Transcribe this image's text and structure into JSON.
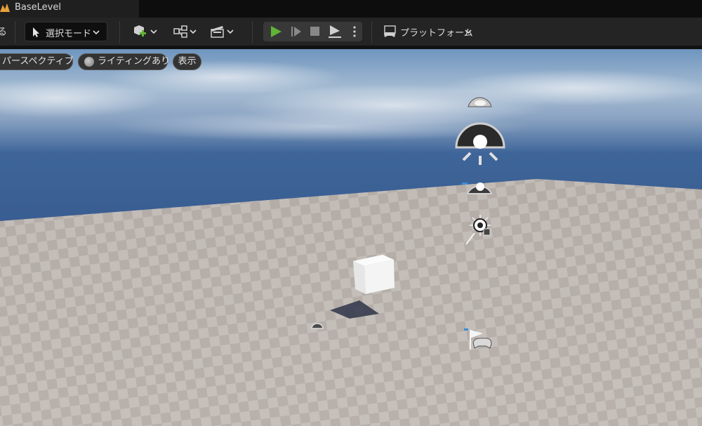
{
  "tab": {
    "title": "BaseLevel",
    "icon": "unreal-level-icon"
  },
  "toolbar": {
    "cut_text": "る",
    "select_mode_label": "選択モード",
    "select_mode_icon": "cursor-select-icon",
    "add_icon": "add-actor-icon",
    "blueprint_icon": "blueprint-icon",
    "cinematics_icon": "clapperboard-icon",
    "play_icon": "play-icon",
    "advance_frame_icon": "advance-frame-icon",
    "stop_icon": "stop-icon",
    "eject_icon": "eject-icon",
    "more_icon": "kebab-menu-icon",
    "platform_label": "プラットフォーム",
    "platform_icon": "gamepad-monitor-icon",
    "play_color": "#5fb336"
  },
  "viewport": {
    "perspective_label": "パースペクティブ",
    "lighting_label": "ライティングあり",
    "show_label": "表示"
  }
}
